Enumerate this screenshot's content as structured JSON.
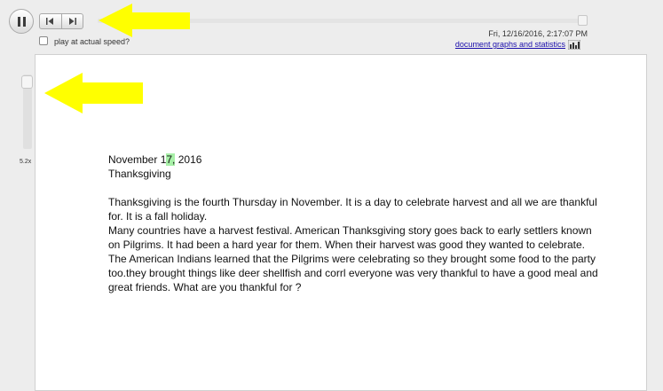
{
  "toolbar": {
    "play_at_speed_label": "play at actual speed?",
    "speed_value": "5.2x",
    "timestamp": "Fri, 12/16/2016, 2:17:07 PM",
    "stats_link": "document graphs and statistics"
  },
  "document": {
    "date_before": "November 1",
    "date_highlight": "7,",
    "date_after": " 2016",
    "title": "Thanksgiving",
    "paragraphs": [
      "Thanksgiving is the fourth Thursday in November. It is a day to celebrate harvest and all we are thankful for. It is a fall holiday.",
      "Many countries have a harvest festival. American Thanksgiving story goes back to early settlers known on Pilgrims. It had been a hard year for them. When their harvest was good they wanted to celebrate.",
      "The American Indians learned that the Pilgrims were celebrating so they brought some food to the party too.they brought things like deer shellfish and corrl everyone was very thankful to have a good meal and great friends. What are you thankful for ?"
    ]
  },
  "colors": {
    "annotation_arrow": "#ffff00",
    "highlight": "#a8f0a8",
    "link": "#1a0dab"
  },
  "icons": [
    "pause-icon",
    "step-back-icon",
    "step-forward-icon",
    "chart-icon",
    "arrow-annotation"
  ]
}
